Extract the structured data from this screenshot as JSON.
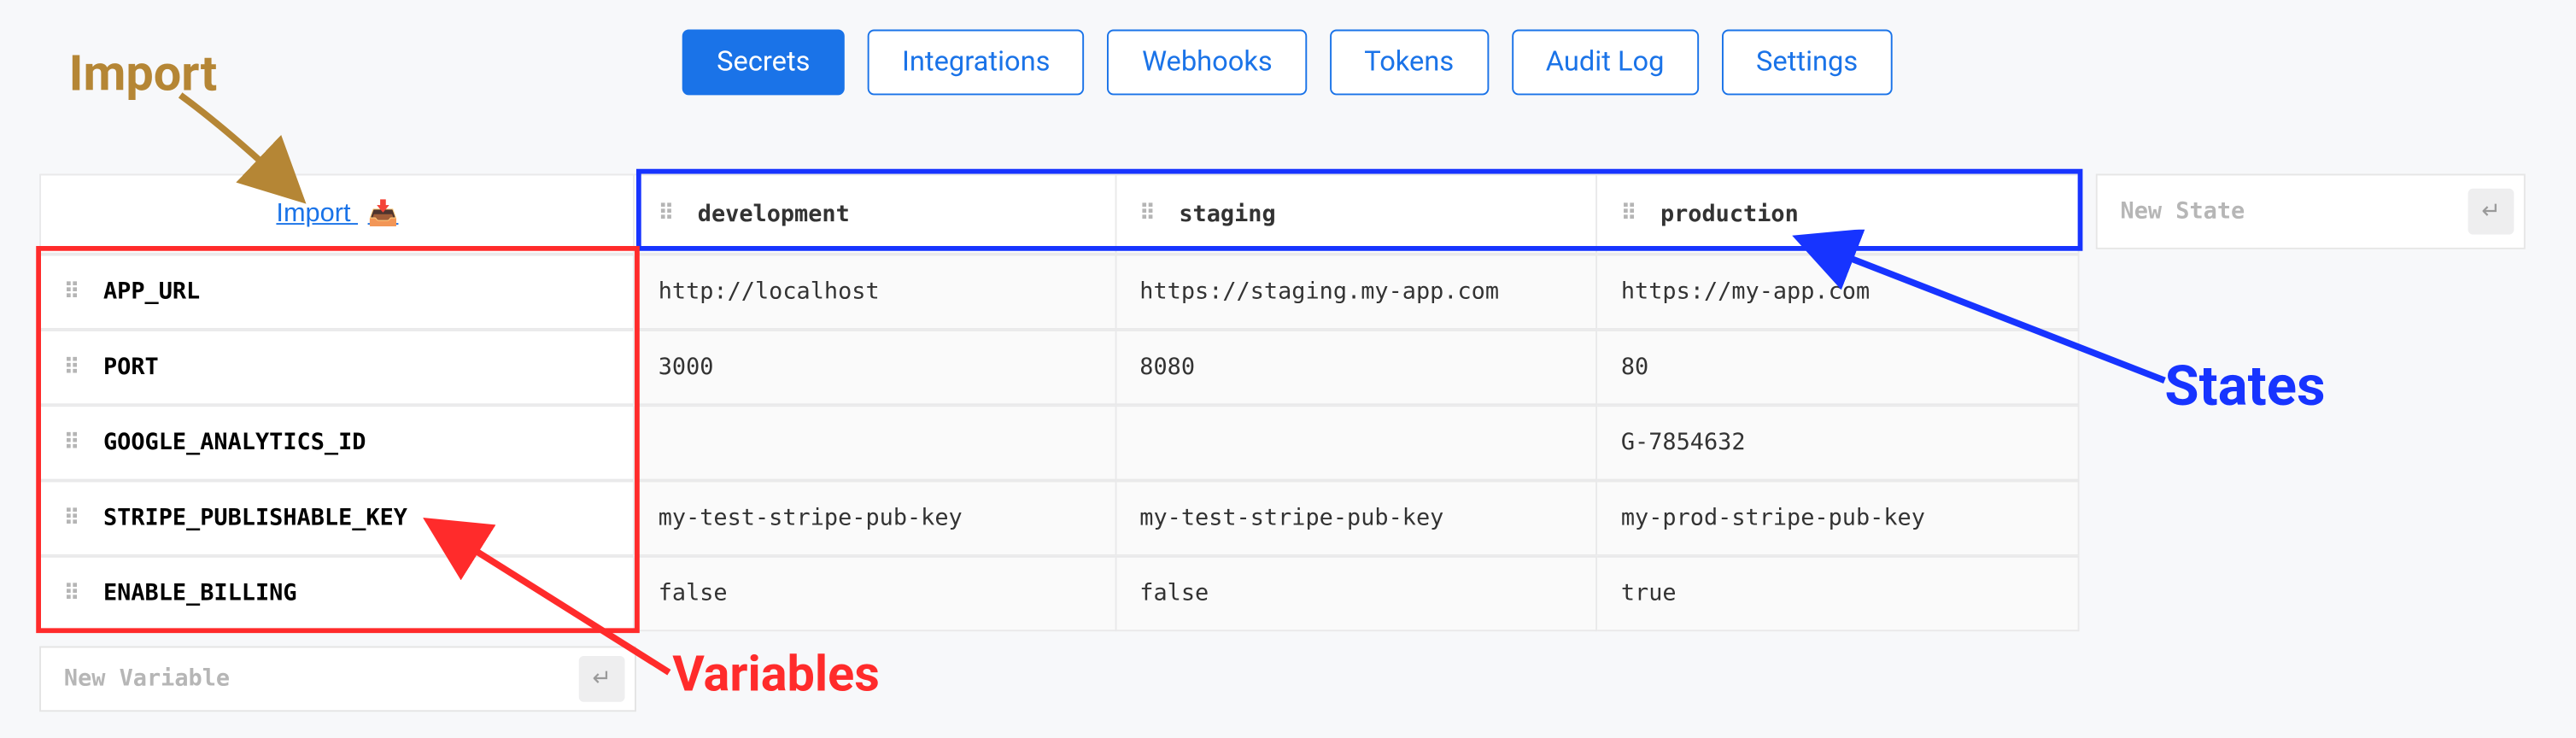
{
  "tabs": {
    "secrets": "Secrets",
    "integrations": "Integrations",
    "webhooks": "Webhooks",
    "tokens": "Tokens",
    "audit_log": "Audit Log",
    "settings": "Settings"
  },
  "import_label": "Import",
  "states": {
    "development": "development",
    "staging": "staging",
    "production": "production"
  },
  "variables": [
    {
      "name": "APP_URL",
      "development": "http://localhost",
      "staging": "https://staging.my-app.com",
      "production": "https://my-app.com"
    },
    {
      "name": "PORT",
      "development": "3000",
      "staging": "8080",
      "production": "80"
    },
    {
      "name": "GOOGLE_ANALYTICS_ID",
      "development": "",
      "staging": "",
      "production": "G-7854632"
    },
    {
      "name": "STRIPE_PUBLISHABLE_KEY",
      "development": "my-test-stripe-pub-key",
      "staging": "my-test-stripe-pub-key",
      "production": "my-prod-stripe-pub-key"
    },
    {
      "name": "ENABLE_BILLING",
      "development": "false",
      "staging": "false",
      "production": "true"
    }
  ],
  "new_variable_placeholder": "New Variable",
  "new_state_placeholder": "New State",
  "annotations": {
    "import": "Import",
    "states": "States",
    "variables": "Variables"
  },
  "colors": {
    "primary": "#1a73e8",
    "ann_import": "#b58635",
    "ann_states": "#1734ff",
    "ann_variables": "#ff2b2b"
  }
}
